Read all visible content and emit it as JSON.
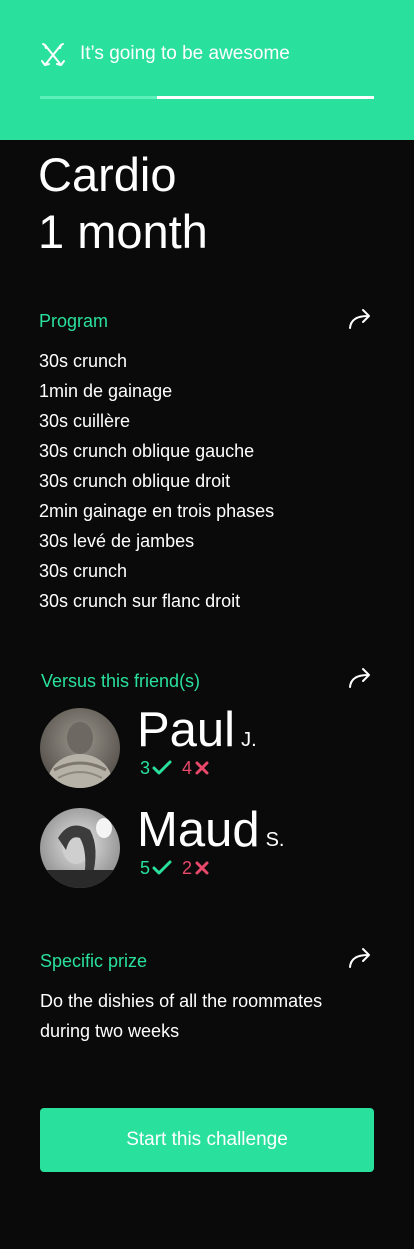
{
  "header": {
    "logo_icon": "crossed-arrows-icon",
    "tagline": "It’s going to be awesome",
    "progress": 0.35,
    "progress_fill_color": "#5ef0bb",
    "bg_color": "#29e09d"
  },
  "challenge": {
    "title_line1": "Cardio",
    "title_line2": "1 month"
  },
  "program": {
    "heading": "Program",
    "share_icon": "share-arrow-icon",
    "items": [
      "30s crunch",
      "1min de gainage",
      "30s cuillère",
      "30s crunch oblique gauche",
      "30s crunch oblique droit",
      "2min gainage en trois phases",
      "30s levé de jambes",
      "30s crunch",
      "30s crunch sur flanc droit"
    ]
  },
  "friends": {
    "heading": "Versus this friend(s)",
    "share_icon": "share-arrow-icon",
    "list": [
      {
        "name": "Paul",
        "initial": "J.",
        "wins": "3",
        "losses": "4",
        "avatar": "avatar-paul"
      },
      {
        "name": "Maud",
        "initial": "S.",
        "wins": "5",
        "losses": "2",
        "avatar": "avatar-maud"
      }
    ]
  },
  "prize": {
    "heading": "Specific prize",
    "share_icon": "share-arrow-icon",
    "text": "Do the dishies of all the roommates during two weeks"
  },
  "cta": {
    "label": "Start this challenge"
  },
  "colors": {
    "accent": "#29e09d",
    "loss": "#e8486a",
    "background": "#0a0a0a"
  }
}
